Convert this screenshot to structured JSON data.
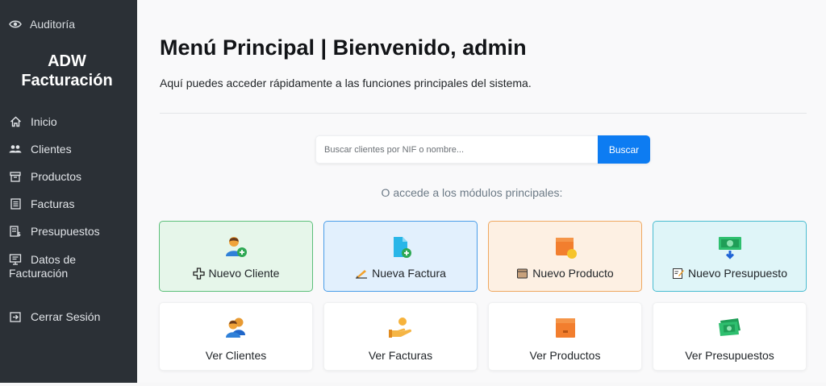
{
  "sidebar": {
    "audit_label": "Auditoría",
    "brand_line1": "ADW",
    "brand_line2": "Facturación",
    "items": [
      {
        "label": "Inicio",
        "icon": "home-icon"
      },
      {
        "label": "Clientes",
        "icon": "users-icon"
      },
      {
        "label": "Productos",
        "icon": "box-icon"
      },
      {
        "label": "Facturas",
        "icon": "invoice-icon"
      },
      {
        "label": "Presupuestos",
        "icon": "budget-icon"
      },
      {
        "label": "Datos de Facturación",
        "icon": "billing-data-icon"
      },
      {
        "label": "Cerrar Sesión",
        "icon": "logout-icon"
      }
    ]
  },
  "main": {
    "title": "Menú Principal | Bienvenido, admin",
    "subtitle": "Aquí puedes acceder rápidamente a las funciones principales del sistema.",
    "search": {
      "placeholder": "Buscar clientes por NIF o nombre...",
      "button_label": "Buscar"
    },
    "modules_label": "O accede a los módulos principales:",
    "quick_cards": [
      {
        "label": "Nuevo Cliente",
        "icon": "add-user-icon",
        "accent": "#5cbf7a"
      },
      {
        "label": "Nueva Factura",
        "icon": "add-document-icon",
        "accent": "#4a9de8"
      },
      {
        "label": "Nuevo Producto",
        "icon": "package-icon",
        "accent": "#efa860"
      },
      {
        "label": "Nuevo Presupuesto",
        "icon": "money-icon",
        "accent": "#48bcd0"
      }
    ],
    "view_cards": [
      {
        "label": "Ver Clientes",
        "icon": "users-color-icon"
      },
      {
        "label": "Ver Facturas",
        "icon": "hand-money-icon"
      },
      {
        "label": "Ver Productos",
        "icon": "package-icon"
      },
      {
        "label": "Ver Presupuestos",
        "icon": "money-stack-icon"
      }
    ]
  }
}
